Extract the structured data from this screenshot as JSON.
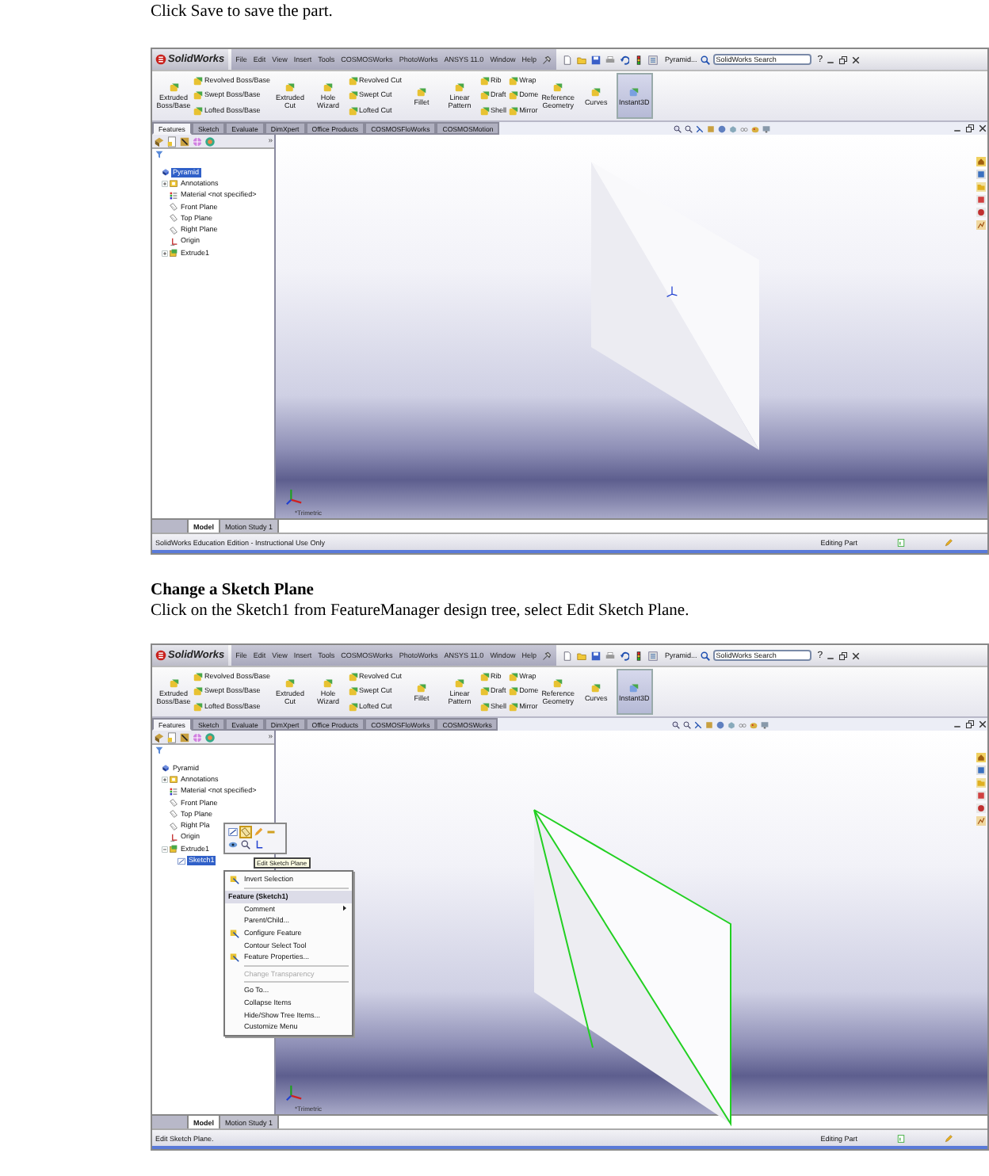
{
  "blocks": [
    {
      "kind": "paragraph",
      "text": "Click Save to save the part."
    },
    {
      "kind": "screenshot",
      "logo": "SolidWorks",
      "menu": [
        "File",
        "Edit",
        "View",
        "Insert",
        "Tools",
        "COSMOSWorks",
        "PhotoWorks",
        "ANSYS 11.0",
        "Window",
        "Help"
      ],
      "doc_title": "Pyramid...",
      "search": {
        "placeholder": "SolidWorks Search"
      },
      "help": "?",
      "ribbon": [
        {
          "kind": "large",
          "label": "Extruded Boss/Base",
          "selected": false
        },
        {
          "kind": "stack",
          "items": [
            "Revolved Boss/Base",
            "Swept Boss/Base",
            "Lofted Boss/Base"
          ]
        },
        {
          "kind": "large",
          "label": "Extruded Cut",
          "selected": false
        },
        {
          "kind": "large",
          "label": "Hole Wizard",
          "selected": false
        },
        {
          "kind": "stack",
          "items": [
            "Revolved Cut",
            "Swept Cut",
            "Lofted Cut"
          ]
        },
        {
          "kind": "large",
          "label": "Fillet",
          "selected": false
        },
        {
          "kind": "large",
          "label": "Linear Pattern",
          "selected": false
        },
        {
          "kind": "stack",
          "items": [
            "Rib",
            "Draft",
            "Shell"
          ]
        },
        {
          "kind": "stack",
          "items": [
            "Wrap",
            "Dome",
            "Mirror"
          ]
        },
        {
          "kind": "large",
          "label": "Reference Geometry",
          "selected": false
        },
        {
          "kind": "large",
          "label": "Curves",
          "selected": false
        },
        {
          "kind": "large",
          "label": "Instant3D",
          "selected": true
        }
      ],
      "cm_tabs": [
        {
          "label": "Features",
          "selected": true
        },
        {
          "label": "Sketch",
          "selected": false
        },
        {
          "label": "Evaluate",
          "selected": false
        },
        {
          "label": "DimXpert",
          "selected": false
        },
        {
          "label": "Office Products",
          "selected": false
        },
        {
          "label": "COSMOSFloWorks",
          "selected": false
        },
        {
          "label": "COSMOSMotion",
          "selected": false
        }
      ],
      "panel_more": "»",
      "tree": [
        {
          "kind": "part",
          "label": "Pyramid",
          "selected": true,
          "children": [
            {
              "kind": "annotations",
              "label": "Annotations",
              "selected": false,
              "expanded": false
            },
            {
              "kind": "material",
              "label": "Material <not specified>",
              "selected": false
            },
            {
              "kind": "plane",
              "label": "Front Plane",
              "selected": false
            },
            {
              "kind": "plane",
              "label": "Top Plane",
              "selected": false
            },
            {
              "kind": "plane",
              "label": "Right Plane",
              "selected": false
            },
            {
              "kind": "origin",
              "label": "Origin",
              "selected": false
            },
            {
              "kind": "feature",
              "label": "Extrude1",
              "selected": false,
              "expanded": false
            }
          ]
        }
      ],
      "origin_shown": true,
      "model_highlight": false,
      "view_label": "*Trimetric",
      "bottom_tabs": [
        {
          "label": "Model",
          "selected": true
        },
        {
          "label": "Motion Study 1",
          "selected": false
        }
      ],
      "status": "SolidWorks Education Edition - Instructional Use Only",
      "status_right": "Editing Part"
    },
    {
      "kind": "heading",
      "text": "Change a Sketch Plane"
    },
    {
      "kind": "paragraph",
      "text": "Click on the Sketch1 from FeatureManager design tree, select Edit Sketch Plane."
    },
    {
      "kind": "screenshot",
      "logo": "SolidWorks",
      "menu": [
        "File",
        "Edit",
        "View",
        "Insert",
        "Tools",
        "COSMOSWorks",
        "PhotoWorks",
        "ANSYS 11.0",
        "Window",
        "Help"
      ],
      "doc_title": "Pyramid...",
      "search": {
        "placeholder": "SolidWorks Search"
      },
      "help": "?",
      "ribbon": [
        {
          "kind": "large",
          "label": "Extruded Boss/Base",
          "selected": false
        },
        {
          "kind": "stack",
          "items": [
            "Revolved Boss/Base",
            "Swept Boss/Base",
            "Lofted Boss/Base"
          ]
        },
        {
          "kind": "large",
          "label": "Extruded Cut",
          "selected": false
        },
        {
          "kind": "large",
          "label": "Hole Wizard",
          "selected": false
        },
        {
          "kind": "stack",
          "items": [
            "Revolved Cut",
            "Swept Cut",
            "Lofted Cut"
          ]
        },
        {
          "kind": "large",
          "label": "Fillet",
          "selected": false
        },
        {
          "kind": "large",
          "label": "Linear Pattern",
          "selected": false
        },
        {
          "kind": "stack",
          "items": [
            "Rib",
            "Draft",
            "Shell"
          ]
        },
        {
          "kind": "stack",
          "items": [
            "Wrap",
            "Dome",
            "Mirror"
          ]
        },
        {
          "kind": "large",
          "label": "Reference Geometry",
          "selected": false
        },
        {
          "kind": "large",
          "label": "Curves",
          "selected": false
        },
        {
          "kind": "large",
          "label": "Instant3D",
          "selected": true
        }
      ],
      "cm_tabs": [
        {
          "label": "Features",
          "selected": true
        },
        {
          "label": "Sketch",
          "selected": false
        },
        {
          "label": "Evaluate",
          "selected": false
        },
        {
          "label": "DimXpert",
          "selected": false
        },
        {
          "label": "Office Products",
          "selected": false
        },
        {
          "label": "COSMOSFloWorks",
          "selected": false
        },
        {
          "label": "COSMOSWorks",
          "selected": false
        }
      ],
      "panel_more": "»",
      "tree": [
        {
          "kind": "part",
          "label": "Pyramid",
          "selected": false,
          "children": [
            {
              "kind": "annotations",
              "label": "Annotations",
              "selected": false,
              "expanded": false
            },
            {
              "kind": "material",
              "label": "Material <not specified>",
              "selected": false
            },
            {
              "kind": "plane",
              "label": "Front Plane",
              "selected": false
            },
            {
              "kind": "plane",
              "label": "Top Plane",
              "selected": false
            },
            {
              "kind": "plane",
              "label": "Right Pla",
              "selected": false
            },
            {
              "kind": "origin",
              "label": "Origin",
              "selected": false
            },
            {
              "kind": "feature",
              "label": "Extrude1",
              "selected": false,
              "expanded": true,
              "children": [
                {
                  "kind": "sketch",
                  "label": "Sketch1",
                  "selected": true
                }
              ]
            }
          ]
        }
      ],
      "origin_shown": false,
      "model_highlight": true,
      "view_label": "*Trimetric",
      "context_menu": {
        "tooltip": "Edit Sketch Plane",
        "items": [
          {
            "kind": "item",
            "label": "Invert Selection",
            "icon": true,
            "submenu": false,
            "disabled": false
          },
          {
            "kind": "separator"
          },
          {
            "kind": "header",
            "label": "Feature (Sketch1)"
          },
          {
            "kind": "item",
            "label": "Comment",
            "icon": false,
            "submenu": true,
            "disabled": false
          },
          {
            "kind": "item",
            "label": "Parent/Child...",
            "icon": false,
            "submenu": false,
            "disabled": false
          },
          {
            "kind": "item",
            "label": "Configure Feature",
            "icon": true,
            "submenu": false,
            "disabled": false
          },
          {
            "kind": "item",
            "label": "Contour Select Tool",
            "icon": false,
            "submenu": false,
            "disabled": false
          },
          {
            "kind": "item",
            "label": "Feature Properties...",
            "icon": true,
            "submenu": false,
            "disabled": false
          },
          {
            "kind": "separator"
          },
          {
            "kind": "item",
            "label": "Change Transparency",
            "icon": false,
            "submenu": false,
            "disabled": true
          },
          {
            "kind": "separator"
          },
          {
            "kind": "item",
            "label": "Go To...",
            "icon": false,
            "submenu": false,
            "disabled": false
          },
          {
            "kind": "item",
            "label": "Collapse Items",
            "icon": false,
            "submenu": false,
            "disabled": false
          },
          {
            "kind": "item",
            "label": "Hide/Show Tree Items...",
            "icon": false,
            "submenu": false,
            "disabled": false
          },
          {
            "kind": "item",
            "label": "Customize Menu",
            "icon": false,
            "submenu": false,
            "disabled": false
          }
        ]
      },
      "bottom_tabs": [
        {
          "label": "Model",
          "selected": true
        },
        {
          "label": "Motion Study 1",
          "selected": false
        }
      ],
      "status": "Edit Sketch Plane.",
      "status_right": "Editing Part"
    }
  ]
}
